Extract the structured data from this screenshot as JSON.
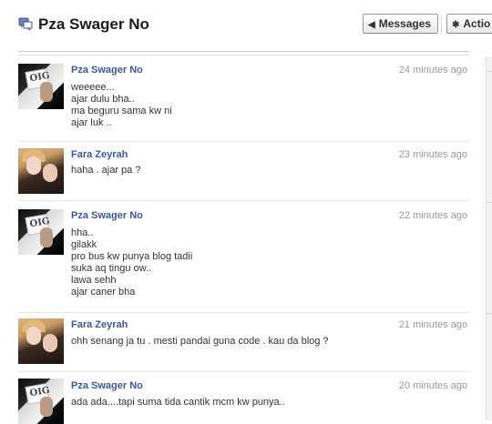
{
  "header": {
    "title": "Pza Swager No",
    "messages_button": "Messages",
    "actions_button": "Actio"
  },
  "messages": [
    {
      "author": "Pza Swager No",
      "time": "24 minutes ago",
      "lines": [
        "weeeee...",
        "ajar dulu bha..",
        "ma beguru sama kw ni",
        "ajar luk .."
      ]
    },
    {
      "author": "Fara Zeyrah",
      "time": "23 minutes ago",
      "lines": [
        "haha . ajar pa ?"
      ]
    },
    {
      "author": "Pza Swager No",
      "time": "22 minutes ago",
      "lines": [
        "hha..",
        "gilakk",
        "pro bus kw punya blog tadii",
        "suka aq tingu ow..",
        "lawa sehh",
        "ajar caner bha"
      ]
    },
    {
      "author": "Fara Zeyrah",
      "time": "21 minutes ago",
      "lines": [
        "ohh senang ja tu . mesti pandai guna code . kau da blog ?"
      ]
    },
    {
      "author": "Pza Swager No",
      "time": "20 minutes ago",
      "lines": [
        "ada ada....tapi suma tida cantik mcm kw punya.."
      ]
    }
  ],
  "avatar_card_text": "OIG"
}
